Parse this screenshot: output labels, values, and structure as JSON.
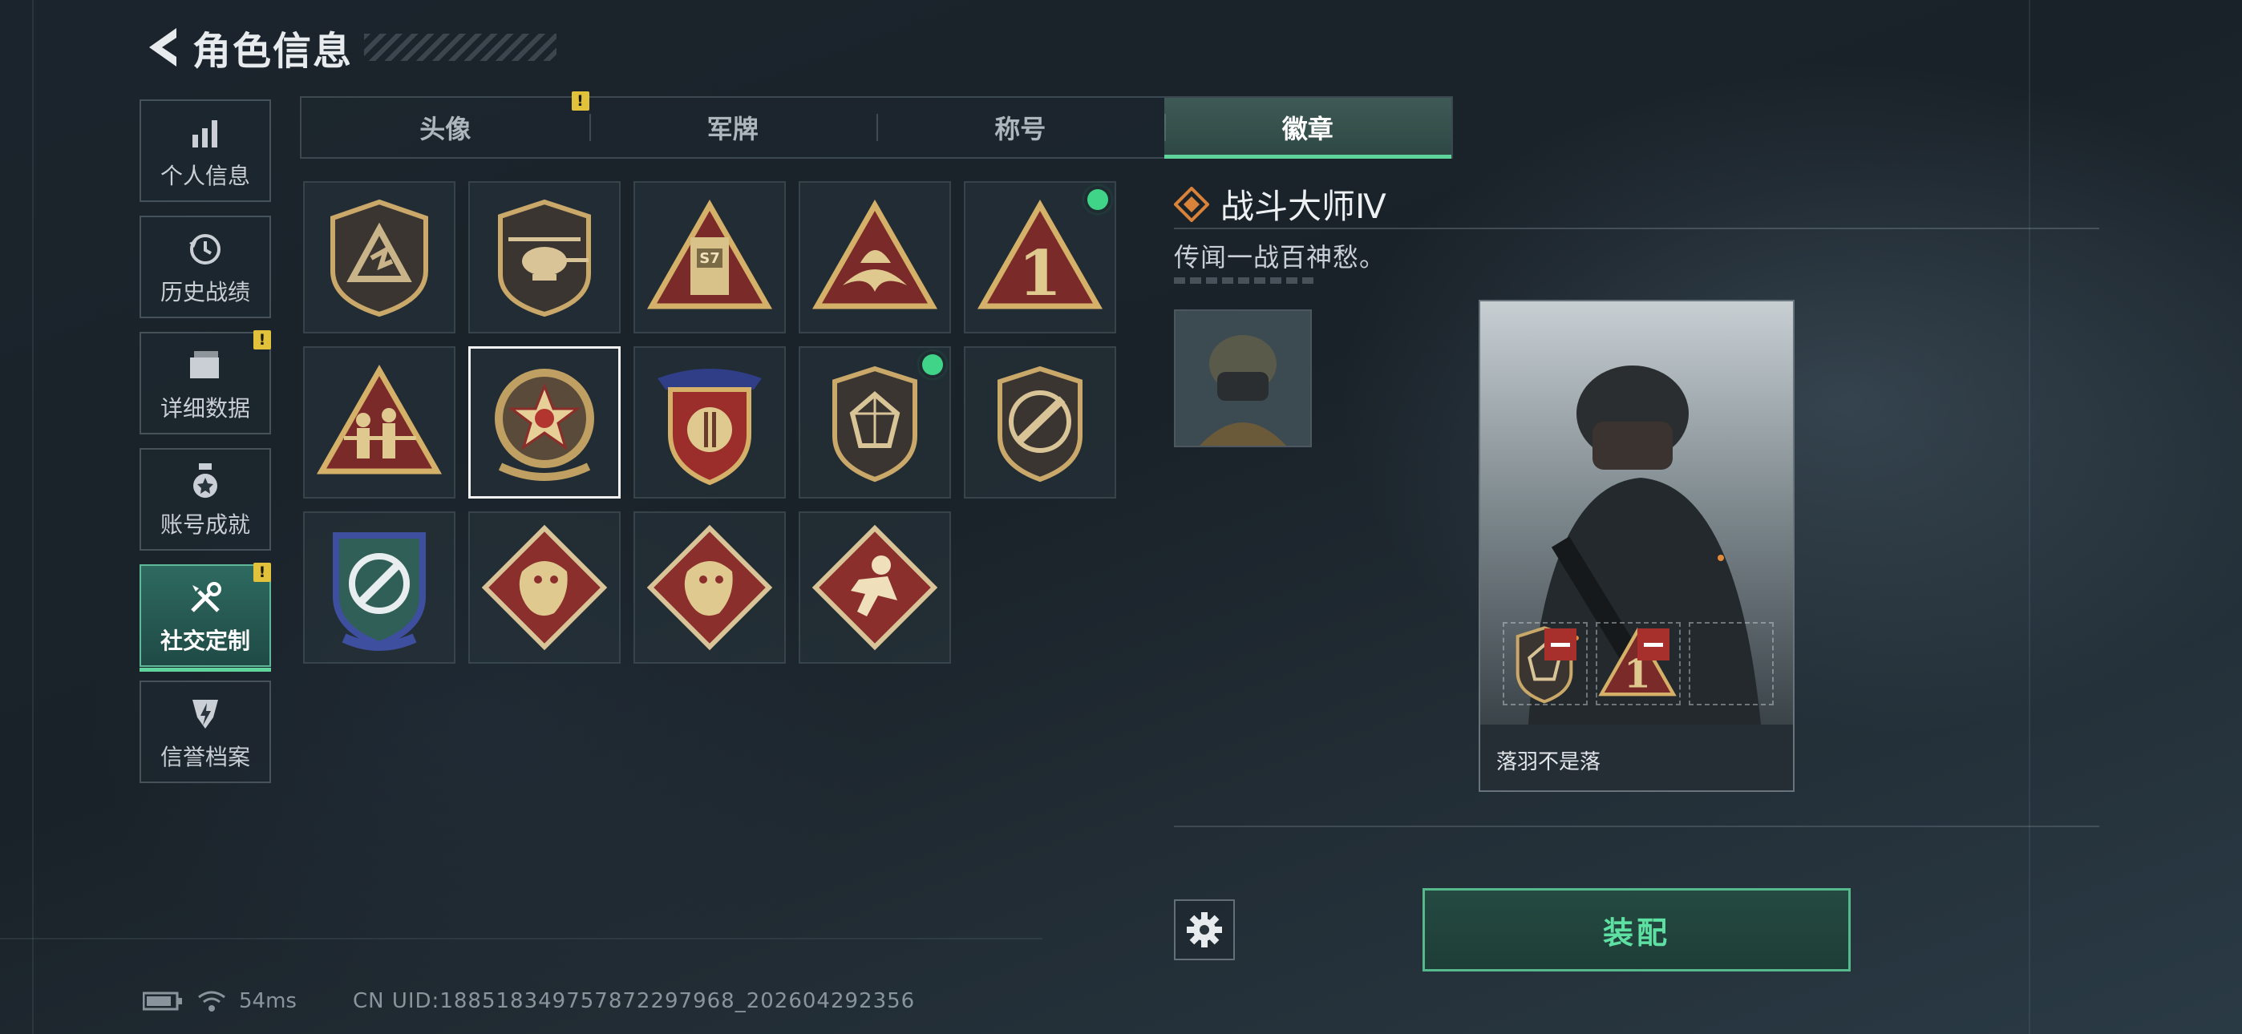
{
  "header": {
    "title": "角色信息"
  },
  "sidebar": {
    "items": [
      {
        "label": "个人信息",
        "icon": "bar-chart-icon",
        "active": false,
        "warning": false
      },
      {
        "label": "历史战绩",
        "icon": "history-clock-icon",
        "active": false,
        "warning": false
      },
      {
        "label": "详细数据",
        "icon": "folder-icon",
        "active": false,
        "warning": true
      },
      {
        "label": "账号成就",
        "icon": "medal-icon",
        "active": false,
        "warning": false
      },
      {
        "label": "社交定制",
        "icon": "tools-icon",
        "active": true,
        "warning": true
      },
      {
        "label": "信誉档案",
        "icon": "shield-bolt-icon",
        "active": false,
        "warning": false
      }
    ]
  },
  "tabs": [
    {
      "label": "头像",
      "active": false,
      "warning": true
    },
    {
      "label": "军牌",
      "active": false,
      "warning": false
    },
    {
      "label": "称号",
      "active": false,
      "warning": false
    },
    {
      "label": "徽章",
      "active": true,
      "warning": false
    }
  ],
  "warning_mark": "!",
  "badges": [
    {
      "name": "triangle-shield-badge",
      "selected": false,
      "new": false
    },
    {
      "name": "helicopter-badge",
      "selected": false,
      "new": false
    },
    {
      "name": "s7-tower-badge",
      "selected": false,
      "new": false
    },
    {
      "name": "wave-triangle-badge",
      "selected": false,
      "new": false
    },
    {
      "name": "number-one-badge",
      "selected": false,
      "new": true
    },
    {
      "name": "soldiers-triangle-badge",
      "selected": false,
      "new": false
    },
    {
      "name": "star-medal-badge",
      "selected": true,
      "new": false
    },
    {
      "name": "crest-stars-badge",
      "selected": false,
      "new": false
    },
    {
      "name": "gem-shield-badge",
      "selected": false,
      "new": true
    },
    {
      "name": "rifle-shield-badge",
      "selected": false,
      "new": false
    },
    {
      "name": "crosshair-blue-badge",
      "selected": false,
      "new": false
    },
    {
      "name": "dragon-diamond-badge",
      "selected": false,
      "new": false
    },
    {
      "name": "dragon-diamond-badge-2",
      "selected": false,
      "new": false
    },
    {
      "name": "runner-diamond-badge",
      "selected": false,
      "new": false
    }
  ],
  "detail": {
    "name": "战斗大师Ⅳ",
    "description": "传闻一战百神愁。",
    "card_player_name": "落羽不是落"
  },
  "actions": {
    "equip_label": "装配"
  },
  "status": {
    "ping": "54ms",
    "uid": "CN UID:1885183497578722979​68_202604292356"
  },
  "colors": {
    "accent": "#5fd49c",
    "warning": "#e2c23a",
    "new_dot": "#3fd487",
    "remove": "#a8302c"
  }
}
